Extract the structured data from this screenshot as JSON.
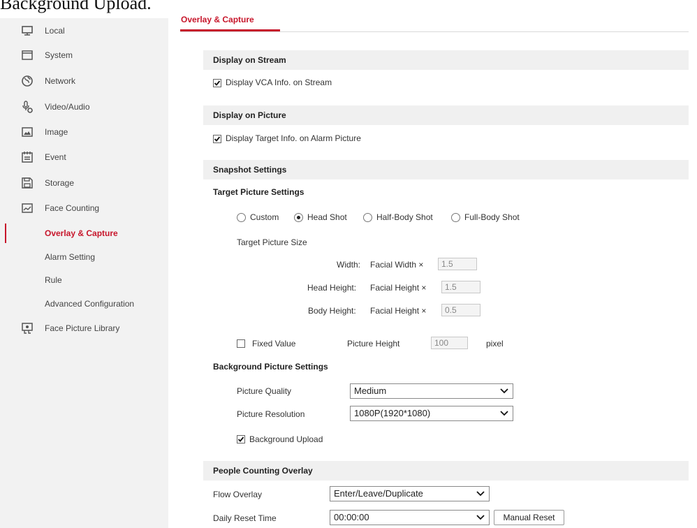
{
  "doc_title": "Background Upload.",
  "sidebar": {
    "items": [
      {
        "label": "Local",
        "icon": "monitor-icon"
      },
      {
        "label": "System",
        "icon": "system-window-icon"
      },
      {
        "label": "Network",
        "icon": "globe-icon"
      },
      {
        "label": "Video/Audio",
        "icon": "microphone-gear-icon"
      },
      {
        "label": "Image",
        "icon": "image-icon"
      },
      {
        "label": "Event",
        "icon": "calendar-icon"
      },
      {
        "label": "Storage",
        "icon": "floppy-disk-icon"
      },
      {
        "label": "Face Counting",
        "icon": "face-counting-icon"
      },
      {
        "label": "Overlay & Capture"
      },
      {
        "label": "Alarm Setting"
      },
      {
        "label": "Rule"
      },
      {
        "label": "Advanced Configuration"
      },
      {
        "label": "Face Picture Library",
        "icon": "face-library-icon"
      }
    ],
    "active_item": "Overlay & Capture"
  },
  "tab": {
    "label": "Overlay & Capture"
  },
  "display_on_stream": {
    "title": "Display on Stream",
    "vca_label": "Display VCA Info. on Stream",
    "vca_checked": true
  },
  "display_on_picture": {
    "title": "Display on Picture",
    "target_label": "Display Target Info. on Alarm Picture",
    "target_checked": true
  },
  "snapshot": {
    "title": "Snapshot Settings",
    "target_picture_title": "Target Picture Settings",
    "options": [
      "Custom",
      "Head Shot",
      "Half-Body Shot",
      "Full-Body Shot"
    ],
    "selected_option": "Head Shot",
    "target_size_label": "Target Picture Size",
    "width_label": "Width:",
    "width_desc": "Facial Width ×",
    "width_value": "1.5",
    "head_height_label": "Head Height:",
    "head_height_desc": "Facial Height ×",
    "head_height_value": "1.5",
    "body_height_label": "Body Height:",
    "body_height_desc": "Facial Height ×",
    "body_height_value": "0.5",
    "fixed_value_label": "Fixed Value",
    "fixed_value_checked": false,
    "picture_height_label": "Picture Height",
    "picture_height_value": "100",
    "pixel_label": "pixel"
  },
  "background": {
    "title": "Background Picture Settings",
    "quality_label": "Picture Quality",
    "quality_value": "Medium",
    "resolution_label": "Picture Resolution",
    "resolution_value": "1080P(1920*1080)",
    "upload_label": "Background Upload",
    "upload_checked": true
  },
  "people_counting": {
    "title": "People Counting Overlay",
    "flow_label": "Flow Overlay",
    "flow_value": "Enter/Leave/Duplicate",
    "reset_label": "Daily Reset Time",
    "reset_value": "00:00:00",
    "manual_reset_button": "Manual Reset"
  },
  "colors": {
    "accent": "#c7162b",
    "sidebar_bg": "#f2f2f2",
    "section_bg": "#f0f0f0"
  }
}
